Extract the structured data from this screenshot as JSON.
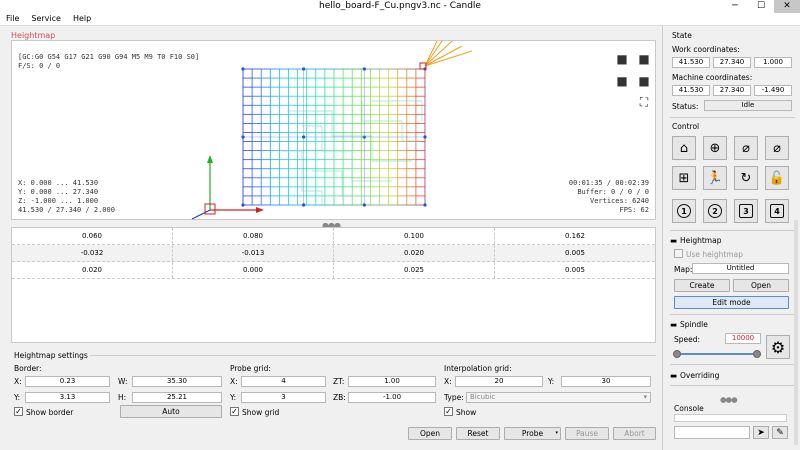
{
  "window": {
    "title": "hello_board-F_Cu.pngv3.nc - Candle"
  },
  "menu": [
    "File",
    "Service",
    "Help"
  ],
  "heightmap_view": {
    "group_title": "Heightmap",
    "gcode_state": "[GC:G0 G54 G17 G21 G90 G94 M5 M9 T0 F10 S0]",
    "feed_speed": "F/S: 0 / 0",
    "x_range": "X: 0.000 ... 41.530",
    "y_range": "Y: 0.000 ... 27.340",
    "z_range": "Z: -1.000 ... 1.000",
    "dims": "41.530 / 27.340 / 2.000",
    "time": "00:01:35 / 00:02:39",
    "buffer": "Buffer: 0 / 0 / 0",
    "vertices": "Vertices: 6240",
    "fps": "FPS: 62"
  },
  "heightmap_table": [
    [
      "0.060",
      "0.080",
      "0.100",
      "0.162"
    ],
    [
      "-0.032",
      "-0.013",
      "0.020",
      "0.005"
    ],
    [
      "0.020",
      "0.000",
      "0.025",
      "0.005"
    ]
  ],
  "heightmap_settings": {
    "title": "Heightmap settings",
    "border_label": "Border:",
    "x_label": "X:",
    "x_value": "0.23",
    "w_label": "W:",
    "w_value": "35.30",
    "y_label": "Y:",
    "y_value": "3.13",
    "h_label": "H:",
    "h_value": "25.21",
    "show_border": "Show border",
    "auto_label": "Auto",
    "probe_grid_label": "Probe grid:",
    "probe_x_value": "4",
    "probe_y_value": "3",
    "zt_label": "ZT:",
    "zt_value": "1.00",
    "zb_label": "ZB:",
    "zb_value": "-1.00",
    "show_grid": "Show grid",
    "interp_label": "Interpolation grid:",
    "interp_x_value": "20",
    "interp_y_value": "30",
    "type_label": "Type:",
    "type_value": "Bicubic",
    "show_label": "Show"
  },
  "bottom_buttons": {
    "open": "Open",
    "reset": "Reset",
    "probe": "Probe",
    "pause": "Pause",
    "abort": "Abort"
  },
  "state": {
    "title": "State",
    "work_label": "Work coordinates:",
    "work": [
      "41.530",
      "27.340",
      "1.000"
    ],
    "machine_label": "Machine coordinates:",
    "machine": [
      "41.530",
      "27.340",
      "-1.490"
    ],
    "status_label": "Status:",
    "status_value": "Idle"
  },
  "control": {
    "title": "Control",
    "nums": [
      "1",
      "2",
      "3",
      "4"
    ]
  },
  "heightmap_side": {
    "title": "Heightmap",
    "use_label": "Use heightmap",
    "map_label": "Map:",
    "map_value": "Untitled",
    "create": "Create",
    "open": "Open",
    "edit_mode": "Edit mode"
  },
  "spindle": {
    "title": "Spindle",
    "speed_label": "Speed:",
    "speed_value": "10000",
    "slider_level": 1.0
  },
  "overriding": {
    "title": "Overriding"
  },
  "console": {
    "title": "Console"
  },
  "colors": {
    "accent": "#d05050",
    "grid_blue": "#2255cc",
    "tool_orange": "#f0a020"
  }
}
